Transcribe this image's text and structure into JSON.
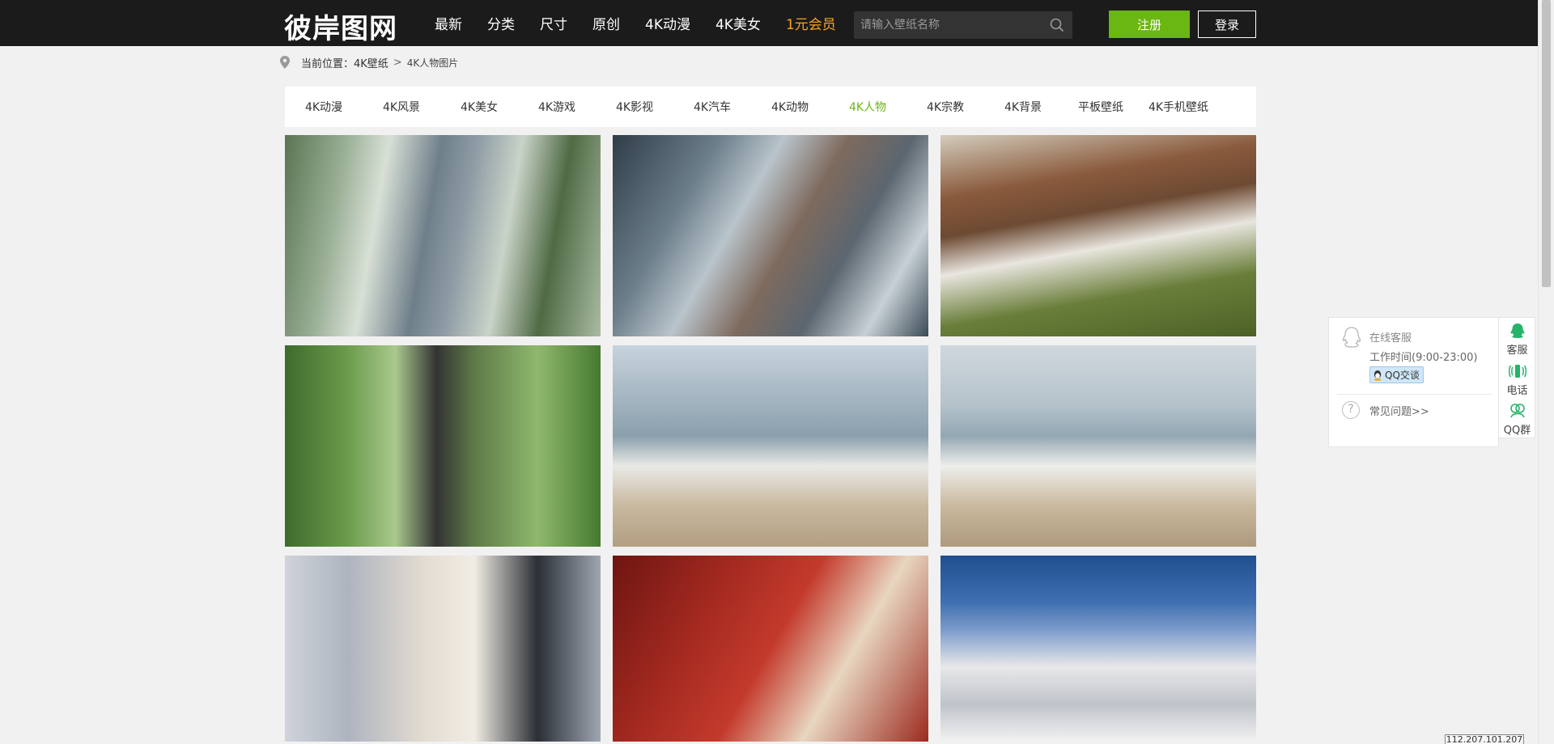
{
  "header": {
    "logo": "彼岸图网",
    "nav": [
      {
        "label": "最新"
      },
      {
        "label": "分类"
      },
      {
        "label": "尺寸"
      },
      {
        "label": "原创"
      },
      {
        "label": "4K动漫"
      },
      {
        "label": "4K美女"
      },
      {
        "label": "1元会员",
        "vip": true
      }
    ],
    "search_placeholder": "请输入壁纸名称",
    "register_label": "注册",
    "login_label": "登录"
  },
  "breadcrumb": {
    "prefix": "当前位置：",
    "parent": "4K壁纸",
    "separator": ">",
    "current": "4K人物图片"
  },
  "categories": [
    {
      "label": "4K动漫"
    },
    {
      "label": "4K风景"
    },
    {
      "label": "4K美女"
    },
    {
      "label": "4K游戏"
    },
    {
      "label": "4K影视"
    },
    {
      "label": "4K汽车"
    },
    {
      "label": "4K动物"
    },
    {
      "label": "4K人物",
      "active": true
    },
    {
      "label": "4K宗教"
    },
    {
      "label": "4K背景"
    },
    {
      "label": "平板壁纸"
    },
    {
      "label": "4K手机壁纸"
    }
  ],
  "service": {
    "online_label": "在线客服",
    "hours": "工作时间(9:00-23:00)",
    "qq_chat_label": "QQ交谈",
    "faq_label": "常见问题>>",
    "side_items": [
      {
        "label": "客服",
        "icon": "headset-icon"
      },
      {
        "label": "电话",
        "icon": "phone-icon"
      },
      {
        "label": "QQ群",
        "icon": "qq-group-icon"
      }
    ]
  },
  "ip_text": "112.207.101.207",
  "theme": {
    "accent": "#6ab613",
    "vip": "#f5a623",
    "header_bg": "#1b1b1b"
  }
}
